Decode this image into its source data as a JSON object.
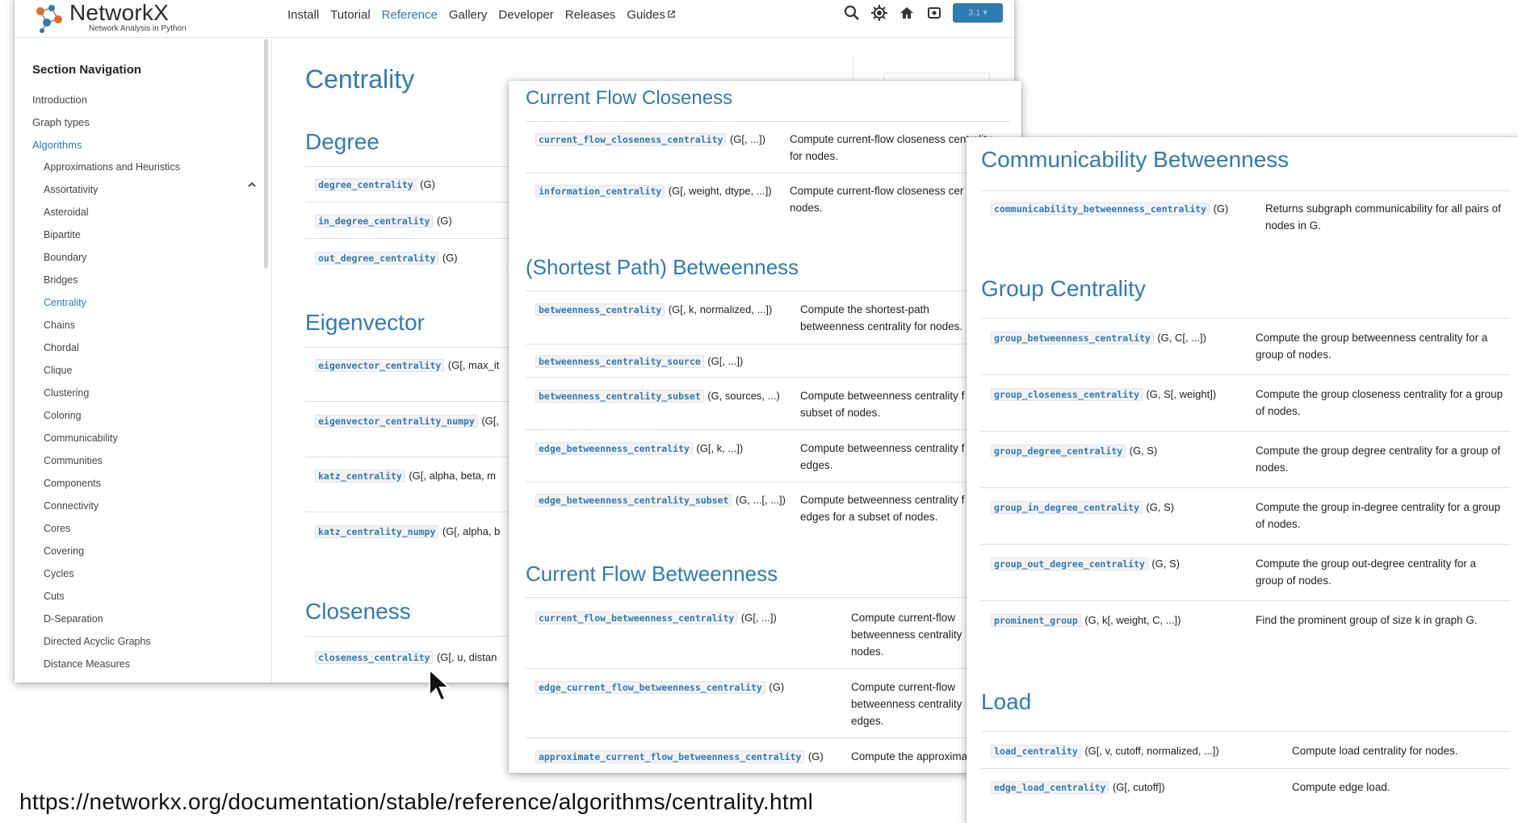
{
  "main_window": {
    "logo": {
      "title": "NetworkX",
      "subtitle": "Network Analysis in Python"
    },
    "nav": [
      "Install",
      "Tutorial",
      "Reference",
      "Gallery",
      "Developer",
      "Releases",
      "Guides"
    ],
    "nav_active": "Reference",
    "version_button": "3.1",
    "sidebar": {
      "title": "Section Navigation",
      "top_items": [
        "Introduction",
        "Graph types",
        "Algorithms"
      ],
      "sub_items": [
        "Approximations and Heuristics",
        "Assortativity",
        "Asteroidal",
        "Bipartite",
        "Boundary",
        "Bridges",
        "Centrality",
        "Chains",
        "Chordal",
        "Clique",
        "Clustering",
        "Coloring",
        "Communicability",
        "Communities",
        "Components",
        "Connectivity",
        "Cores",
        "Covering",
        "Cycles",
        "Cuts",
        "D-Separation",
        "Directed Acyclic Graphs",
        "Distance Measures"
      ],
      "active": "Centrality"
    },
    "page_title": "Centrality",
    "sections": {
      "degree": {
        "heading": "Degree",
        "rows": [
          {
            "name": "degree_centrality",
            "sig": "(G)"
          },
          {
            "name": "in_degree_centrality",
            "sig": "(G)"
          },
          {
            "name": "out_degree_centrality",
            "sig": "(G)"
          }
        ]
      },
      "eigenvector": {
        "heading": "Eigenvector",
        "rows": [
          {
            "name": "eigenvector_centrality",
            "sig": "(G[, max_it"
          },
          {
            "name": "eigenvector_centrality_numpy",
            "sig": "(G[,"
          },
          {
            "name": "katz_centrality",
            "sig": "(G[, alpha, beta, m"
          },
          {
            "name": "katz_centrality_numpy",
            "sig": "(G[, alpha, b"
          }
        ]
      },
      "closeness": {
        "heading": "Closeness",
        "rows": [
          {
            "name": "closeness_centrality",
            "sig": "(G[, u, distan"
          }
        ]
      }
    }
  },
  "middle_window": {
    "current_flow_closeness": {
      "heading": "Current Flow Closeness",
      "rows": [
        {
          "name": "current_flow_closeness_centrality",
          "sig": "(G[, ...])",
          "desc": "Compute current-flow closeness centrality for nodes."
        },
        {
          "name": "information_centrality",
          "sig": "(G[, weight, dtype, ...])",
          "desc": "Compute current-flow closeness cer for nodes."
        }
      ]
    },
    "shortest_path_betweenness": {
      "heading": "(Shortest Path) Betweenness",
      "rows": [
        {
          "name": "betweenness_centrality",
          "sig": "(G[, k, normalized, ...])",
          "desc": "Compute the shortest-path betweenness centrality for nodes."
        },
        {
          "name": "betweenness_centrality_source",
          "sig": "(G[, ...])",
          "desc": ""
        },
        {
          "name": "betweenness_centrality_subset",
          "sig": "(G, sources, ...)",
          "desc": "Compute betweenness centrality f subset of nodes."
        },
        {
          "name": "edge_betweenness_centrality",
          "sig": "(G[, k, ...])",
          "desc": "Compute betweenness centrality f edges."
        },
        {
          "name": "edge_betweenness_centrality_subset",
          "sig": "(G, ...[, ...])",
          "desc": "Compute betweenness centrality f edges for a subset of nodes."
        }
      ]
    },
    "current_flow_betweenness": {
      "heading": "Current Flow Betweenness",
      "rows": [
        {
          "name": "current_flow_betweenness_centrality",
          "sig": "(G[, ...])",
          "desc": "Compute current-flow betweenness centrality nodes."
        },
        {
          "name": "edge_current_flow_betweenness_centrality",
          "sig": "(G)",
          "desc": "Compute current-flow betweenness centrality edges."
        },
        {
          "name": "approximate_current_flow_betweenness_centrality",
          "sig": "(G)",
          "desc": "Compute the approxima"
        }
      ]
    }
  },
  "right_window": {
    "communicability": {
      "heading": "Communicability Betweenness",
      "rows": [
        {
          "name": "communicability_betweenness_centrality",
          "sig": "(G)",
          "desc": "Returns subgraph communicability for all pairs of nodes in G."
        }
      ]
    },
    "group": {
      "heading": "Group Centrality",
      "rows": [
        {
          "name": "group_betweenness_centrality",
          "sig": "(G, C[, ...])",
          "desc": "Compute the group betweenness centrality for a group of nodes."
        },
        {
          "name": "group_closeness_centrality",
          "sig": "(G, S[, weight])",
          "desc": "Compute the group closeness centrality for a group of nodes."
        },
        {
          "name": "group_degree_centrality",
          "sig": "(G, S)",
          "desc": "Compute the group degree centrality for a group of nodes."
        },
        {
          "name": "group_in_degree_centrality",
          "sig": "(G, S)",
          "desc": "Compute the group in-degree centrality for a group of nodes."
        },
        {
          "name": "group_out_degree_centrality",
          "sig": "(G, S)",
          "desc": "Compute the group out-degree centrality for a group of nodes."
        },
        {
          "name": "prominent_group",
          "sig": "(G, k[, weight, C, ...])",
          "desc": "Find the prominent group of size k in graph G."
        }
      ]
    },
    "load": {
      "heading": "Load",
      "rows": [
        {
          "name": "load_centrality",
          "sig": "(G[, v, cutoff, normalized, ...])",
          "desc": "Compute load centrality for nodes."
        },
        {
          "name": "edge_load_centrality",
          "sig": "(G[, cutoff])",
          "desc": "Compute edge load."
        }
      ]
    }
  },
  "url_caption": "https://networkx.org/documentation/stable/reference/algorithms/centrality.html",
  "colors": {
    "accent": "#2e7bb3",
    "text": "#222222",
    "code_bg": "#f3f3f6"
  }
}
